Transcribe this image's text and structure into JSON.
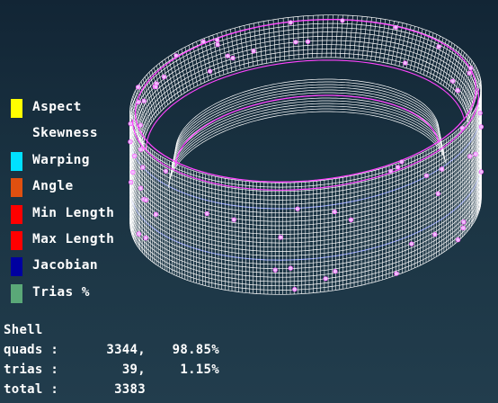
{
  "legend": [
    {
      "label": "Aspect",
      "color": "#ffff00"
    },
    {
      "label": "Skewness",
      "color": ""
    },
    {
      "label": "Warping",
      "color": "#00e0ff"
    },
    {
      "label": "Angle",
      "color": "#e05010"
    },
    {
      "label": "Min Length",
      "color": "#ff0000"
    },
    {
      "label": "Max Length",
      "color": "#ff0000"
    },
    {
      "label": "Jacobian",
      "color": "#0000a0"
    },
    {
      "label": "Trias %",
      "color": "#5aa878"
    }
  ],
  "stats": {
    "title": "Shell",
    "rows": [
      {
        "label": "quads :",
        "count": "3344,",
        "percent": "98.85%"
      },
      {
        "label": "trias :",
        "count": "39,",
        "percent": "1.15%"
      },
      {
        "label": "total :",
        "count": "3383",
        "percent": ""
      }
    ]
  },
  "mesh": {
    "line_color": "#ffffff",
    "highlight_color": "#ff44ff",
    "accent_color": "#9aa8ff",
    "node_color": "#f0c0ff"
  }
}
